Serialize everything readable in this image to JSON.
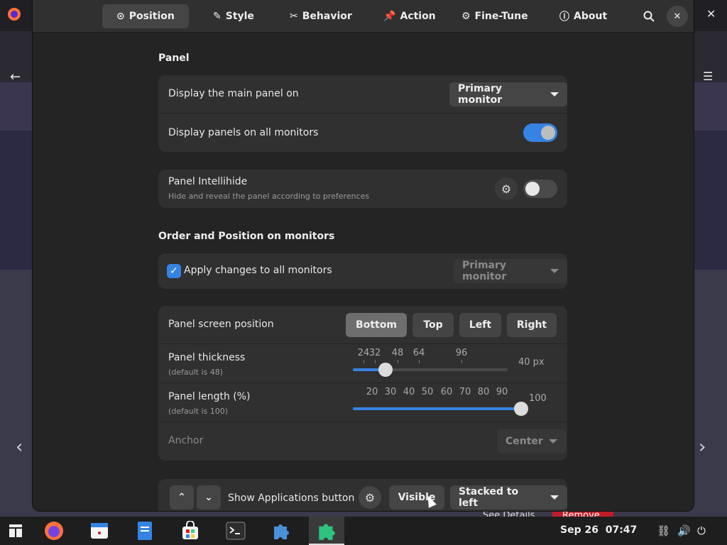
{
  "background": {
    "peek_left": "See Details",
    "peek_right": "Remove",
    "peek_right_color": "#c01c28"
  },
  "header": {
    "tabs": [
      {
        "label": "Position",
        "icon": "target-icon"
      },
      {
        "label": "Style",
        "icon": "brush-icon"
      },
      {
        "label": "Behavior",
        "icon": "tools-icon"
      },
      {
        "label": "Action",
        "icon": "pin-icon"
      },
      {
        "label": "Fine-Tune",
        "icon": "sliders-icon"
      },
      {
        "label": "About",
        "icon": "info-icon"
      }
    ],
    "active_tab": "Position"
  },
  "panel": {
    "title": "Panel",
    "main_panel_label": "Display the main panel on",
    "main_panel_value": "Primary monitor",
    "all_monitors_label": "Display panels on all monitors",
    "all_monitors_on": true,
    "intellihide_label": "Panel Intellihide",
    "intellihide_sub": "Hide and reveal the panel according to preferences",
    "intellihide_on": false
  },
  "order": {
    "title": "Order and Position on monitors",
    "apply_label": "Apply changes to all monitors",
    "apply_checked": true,
    "monitor_value": "Primary monitor",
    "position_label": "Panel screen position",
    "positions": [
      "Bottom",
      "Top",
      "Left",
      "Right"
    ],
    "active_position": "Bottom",
    "thickness_label": "Panel thickness",
    "thickness_sub": "(default is 48)",
    "thickness_ticks": [
      "24",
      "32",
      "48",
      "64",
      "96"
    ],
    "thickness_value": "40 px",
    "length_label": "Panel length (%)",
    "length_sub": "(default is 100)",
    "length_ticks": [
      "20",
      "30",
      "40",
      "50",
      "60",
      "70",
      "80",
      "90"
    ],
    "length_value": "100",
    "anchor_label": "Anchor",
    "anchor_value": "Center"
  },
  "apps_row": {
    "label": "Show Applications button",
    "visible_label": "Visible",
    "stacking_value": "Stacked to left"
  },
  "taskbar": {
    "date": "Sep 26",
    "time": "07:47"
  },
  "colors": {
    "accent": "#3584e4",
    "dialog_bg": "#242424",
    "card_bg": "#303030"
  }
}
